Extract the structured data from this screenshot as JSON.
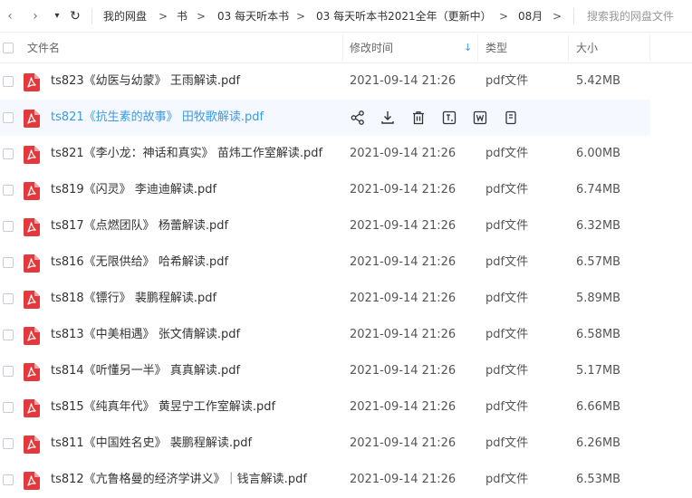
{
  "topbar": {
    "nav": {
      "back": "‹",
      "forward": "›",
      "dropdown": "▾",
      "refresh": "↻"
    },
    "breadcrumbs": [
      "我的网盘",
      "书",
      "03 每天听本书",
      "03 每天听本书2021全年（更新中）",
      "08月"
    ],
    "separator": ">",
    "search_placeholder": "搜索我的网盘文件"
  },
  "table": {
    "headers": {
      "name": "文件名",
      "modified": "修改时间",
      "sort_indicator": "↓",
      "type": "类型",
      "size": "大小"
    },
    "rows": [
      {
        "name": "ts823《幼医与幼蒙》 王雨解读.pdf",
        "modified": "2021-09-14 21:26",
        "type": "pdf文件",
        "size": "5.42MB"
      },
      {
        "name": "ts821《抗生素的故事》 田牧歌解读.pdf",
        "modified": "",
        "type": "",
        "size": ""
      },
      {
        "name": "ts821《李小龙：神话和真实》 苗炜工作室解读.pdf",
        "modified": "2021-09-14 21:26",
        "type": "pdf文件",
        "size": "6.00MB"
      },
      {
        "name": "ts819《闪灵》 李迪迪解读.pdf",
        "modified": "2021-09-14 21:26",
        "type": "pdf文件",
        "size": "6.74MB"
      },
      {
        "name": "ts817《点燃团队》 杨蕾解读.pdf",
        "modified": "2021-09-14 21:26",
        "type": "pdf文件",
        "size": "6.32MB"
      },
      {
        "name": "ts816《无限供给》 哈希解读.pdf",
        "modified": "2021-09-14 21:26",
        "type": "pdf文件",
        "size": "6.57MB"
      },
      {
        "name": "ts818《镖行》 裴鹏程解读.pdf",
        "modified": "2021-09-14 21:26",
        "type": "pdf文件",
        "size": "5.89MB"
      },
      {
        "name": "ts813《中美相遇》 张文倩解读.pdf",
        "modified": "2021-09-14 21:26",
        "type": "pdf文件",
        "size": "6.58MB"
      },
      {
        "name": "ts814《听懂另一半》 真真解读.pdf",
        "modified": "2021-09-14 21:26",
        "type": "pdf文件",
        "size": "5.17MB"
      },
      {
        "name": "ts815《纯真年代》 黄昱宁工作室解读.pdf",
        "modified": "2021-09-14 21:26",
        "type": "pdf文件",
        "size": "6.66MB"
      },
      {
        "name": "ts811《中国姓名史》 裴鹏程解读.pdf",
        "modified": "2021-09-14 21:26",
        "type": "pdf文件",
        "size": "6.26MB"
      },
      {
        "name": "ts812《亢鲁格曼的经济学讲义》｜钱言解读.pdf",
        "modified": "2021-09-14 21:26",
        "type": "pdf文件",
        "size": "6.53MB"
      }
    ]
  },
  "hover_row_actions": [
    "share-icon",
    "download-icon",
    "delete-icon",
    "text-extract-icon",
    "convert-to-word-icon",
    "more-icon"
  ],
  "colors": {
    "accent": "#3a9ae8",
    "pdf_red": "#e4393c",
    "hover_bg": "#f5f8fe"
  }
}
